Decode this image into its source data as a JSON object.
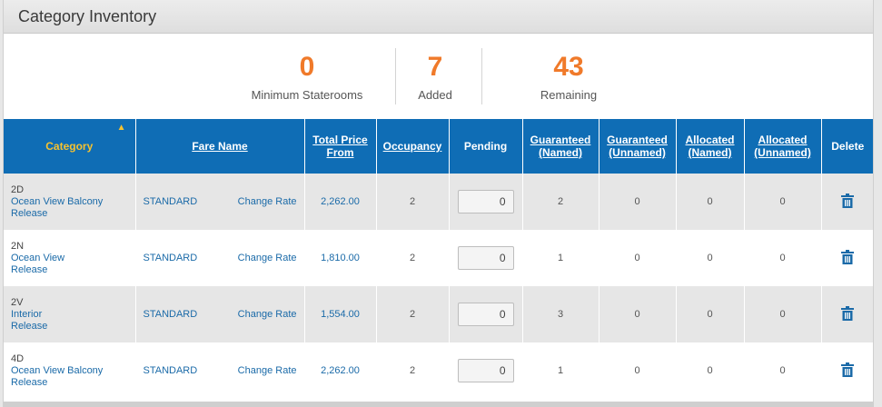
{
  "panel": {
    "title": "Category Inventory"
  },
  "summary": [
    {
      "value": "0",
      "label": "Minimum Staterooms"
    },
    {
      "value": "7",
      "label": "Added"
    },
    {
      "value": "43",
      "label": "Remaining"
    }
  ],
  "columns": {
    "category": "Category",
    "fare_name": "Fare Name",
    "total_price_1": "Total Price",
    "total_price_2": "From",
    "occupancy": "Occupancy",
    "pending": "Pending",
    "guaranteed_named_1": "Guaranteed",
    "guaranteed_named_2": "(Named)",
    "guaranteed_unnamed_1": "Guaranteed",
    "guaranteed_unnamed_2": "(Unnamed)",
    "allocated_named_1": "Allocated",
    "allocated_named_2": "(Named)",
    "allocated_unnamed_1": "Allocated",
    "allocated_unnamed_2": "(Unnamed)",
    "delete": "Delete"
  },
  "icons": {
    "sort": "sort-up-icon",
    "delete": "trash-icon"
  },
  "colors": {
    "header_bg": "#0f6db5",
    "accent": "#f07a2a",
    "link": "#1a6aa8",
    "sorted_header": "#f5c230"
  },
  "rows": [
    {
      "code": "2D",
      "name": "Ocean View Balcony",
      "release": "Release",
      "fare": "STANDARD",
      "change": "Change Rate",
      "price": "2,262.00",
      "occupancy": "2",
      "pending": "0",
      "g_named": "2",
      "g_unnamed": "0",
      "a_named": "0",
      "a_unnamed": "0"
    },
    {
      "code": "2N",
      "name": "Ocean View",
      "release": "Release",
      "fare": "STANDARD",
      "change": "Change Rate",
      "price": "1,810.00",
      "occupancy": "2",
      "pending": "0",
      "g_named": "1",
      "g_unnamed": "0",
      "a_named": "0",
      "a_unnamed": "0"
    },
    {
      "code": "2V",
      "name": "Interior",
      "release": "Release",
      "fare": "STANDARD",
      "change": "Change Rate",
      "price": "1,554.00",
      "occupancy": "2",
      "pending": "0",
      "g_named": "3",
      "g_unnamed": "0",
      "a_named": "0",
      "a_unnamed": "0"
    },
    {
      "code": "4D",
      "name": "Ocean View Balcony",
      "release": "Release",
      "fare": "STANDARD",
      "change": "Change Rate",
      "price": "2,262.00",
      "occupancy": "2",
      "pending": "0",
      "g_named": "1",
      "g_unnamed": "0",
      "a_named": "0",
      "a_unnamed": "0"
    }
  ]
}
